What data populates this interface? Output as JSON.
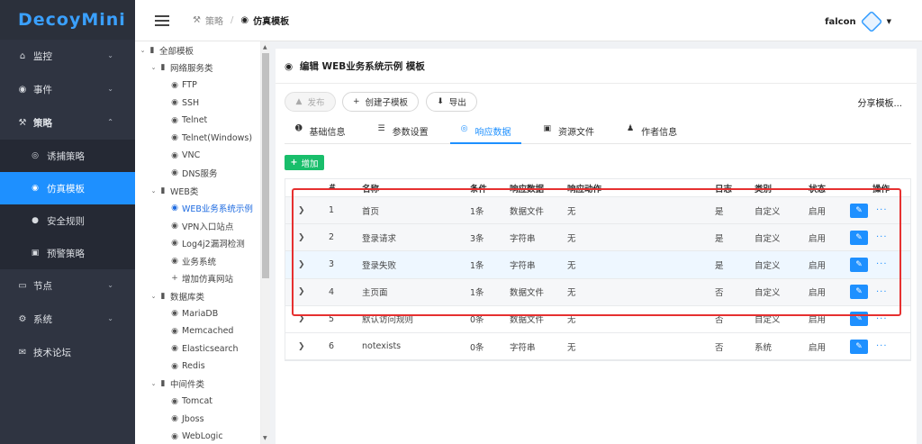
{
  "app": {
    "logo": "DecoyMini"
  },
  "sidebar": {
    "items": [
      {
        "label": "监控",
        "icon": "home-icon"
      },
      {
        "label": "事件",
        "icon": "target-icon"
      },
      {
        "label": "策略",
        "icon": "tools-icon"
      },
      {
        "label": "节点",
        "icon": "monitor-icon"
      },
      {
        "label": "系统",
        "icon": "gear-icon"
      },
      {
        "label": "技术论坛",
        "icon": "chat-icon"
      }
    ],
    "subitems": [
      {
        "label": "诱捕策略",
        "icon": "eye-icon"
      },
      {
        "label": "仿真模板",
        "icon": "cube-icon"
      },
      {
        "label": "安全规则",
        "icon": "record-icon"
      },
      {
        "label": "预警策略",
        "icon": "briefcase-icon"
      }
    ]
  },
  "header": {
    "breadcrumb": [
      "策略",
      "仿真模板"
    ],
    "user": "falcon"
  },
  "tree": [
    {
      "label": "全部模板",
      "level": 0,
      "type": "folder"
    },
    {
      "label": "网络服务类",
      "level": 1,
      "type": "folder"
    },
    {
      "label": "FTP",
      "level": 2,
      "type": "leaf"
    },
    {
      "label": "SSH",
      "level": 2,
      "type": "leaf"
    },
    {
      "label": "Telnet",
      "level": 2,
      "type": "leaf"
    },
    {
      "label": "Telnet(Windows)",
      "level": 2,
      "type": "leaf"
    },
    {
      "label": "VNC",
      "level": 2,
      "type": "leaf"
    },
    {
      "label": "DNS服务",
      "level": 2,
      "type": "leaf"
    },
    {
      "label": "WEB类",
      "level": 1,
      "type": "folder"
    },
    {
      "label": "WEB业务系统示例",
      "level": 2,
      "type": "leaf",
      "selected": true
    },
    {
      "label": "VPN入口站点",
      "level": 2,
      "type": "leaf"
    },
    {
      "label": "Log4j2漏洞检测",
      "level": 2,
      "type": "leaf"
    },
    {
      "label": "业务系统",
      "level": 2,
      "type": "leaf"
    },
    {
      "label": "增加仿真网站",
      "level": 2,
      "type": "add"
    },
    {
      "label": "数据库类",
      "level": 1,
      "type": "folder"
    },
    {
      "label": "MariaDB",
      "level": 2,
      "type": "leaf"
    },
    {
      "label": "Memcached",
      "level": 2,
      "type": "leaf"
    },
    {
      "label": "Elasticsearch",
      "level": 2,
      "type": "leaf"
    },
    {
      "label": "Redis",
      "level": 2,
      "type": "leaf"
    },
    {
      "label": "中间件类",
      "level": 1,
      "type": "folder"
    },
    {
      "label": "Tomcat",
      "level": 2,
      "type": "leaf"
    },
    {
      "label": "Jboss",
      "level": 2,
      "type": "leaf"
    },
    {
      "label": "WebLogic",
      "level": 2,
      "type": "leaf"
    }
  ],
  "panel": {
    "title": "编辑 WEB业务系统示例 模板",
    "publish": "发布",
    "create_child": "创建子模板",
    "export": "导出",
    "share": "分享模板...",
    "tabs": [
      "基础信息",
      "参数设置",
      "响应数据",
      "资源文件",
      "作者信息"
    ],
    "active_tab": "响应数据",
    "add": "增加"
  },
  "table": {
    "headers": [
      "#",
      "名称",
      "条件",
      "响应数据",
      "响应动作",
      "日志",
      "类别",
      "状态",
      "操作"
    ],
    "rows": [
      [
        "1",
        "首页",
        "1条",
        "数据文件",
        "无",
        "是",
        "自定义",
        "启用"
      ],
      [
        "2",
        "登录请求",
        "3条",
        "字符串",
        "无",
        "是",
        "自定义",
        "启用"
      ],
      [
        "3",
        "登录失败",
        "1条",
        "字符串",
        "无",
        "是",
        "自定义",
        "启用"
      ],
      [
        "4",
        "主页面",
        "1条",
        "数据文件",
        "无",
        "否",
        "自定义",
        "启用"
      ],
      [
        "5",
        "默认访问规则",
        "0条",
        "数据文件",
        "无",
        "否",
        "自定义",
        "启用"
      ],
      [
        "6",
        "notexists",
        "0条",
        "字符串",
        "无",
        "否",
        "系统",
        "启用"
      ]
    ],
    "more": "···"
  },
  "colors": {
    "accent": "#1e90ff",
    "sidebar": "#2f3441",
    "add_button": "#19be6b",
    "highlight_box": "#e63030"
  }
}
